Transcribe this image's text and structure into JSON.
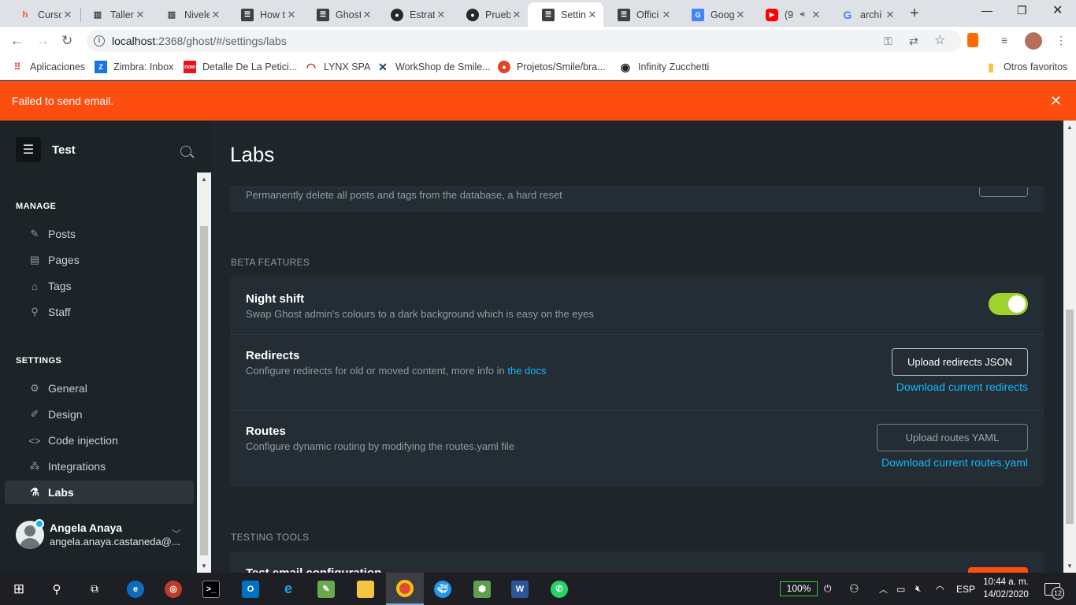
{
  "browser": {
    "tabs": [
      {
        "title": "Curso",
        "favicon": "hotmart-icon",
        "color": "#f04e23"
      },
      {
        "title": "Taller",
        "favicon": "book-icon",
        "color": "#3c4043"
      },
      {
        "title": "Nivele",
        "favicon": "book-icon",
        "color": "#3c4043"
      },
      {
        "title": "How t",
        "favicon": "ghost-icon",
        "color": "#3c4043"
      },
      {
        "title": "Ghost",
        "favicon": "ghost-icon",
        "color": "#3c4043"
      },
      {
        "title": "Estrat",
        "favicon": "github-icon",
        "color": "#24292e"
      },
      {
        "title": "Prueb",
        "favicon": "github-icon",
        "color": "#24292e"
      },
      {
        "title": "Settin",
        "favicon": "ghost-icon",
        "color": "#3c4043",
        "active": true
      },
      {
        "title": "Offici",
        "favicon": "ghost-icon",
        "color": "#3c4043"
      },
      {
        "title": "Goog",
        "favicon": "google-translate-icon",
        "color": "#4285f4"
      },
      {
        "title": "(9",
        "favicon": "youtube-icon",
        "color": "#ff0000"
      },
      {
        "title": "archi",
        "favicon": "google-icon",
        "color": "#4285f4"
      }
    ],
    "url_host": "localhost",
    "url_path": ":2368/ghost/#/settings/labs",
    "bookmarks": [
      {
        "label": "Aplicaciones",
        "icon": "apps-grid-icon"
      },
      {
        "label": "Zimbra: Inbox",
        "icon": "zimbra-icon"
      },
      {
        "label": "Detalle De La Petici...",
        "icon": "now-icon"
      },
      {
        "label": "LYNX SPA",
        "icon": "lynx-icon"
      },
      {
        "label": "WorkShop de Smile...",
        "icon": "x-icon"
      },
      {
        "label": "Projetos/Smile/bra...",
        "icon": "chrome-icon"
      },
      {
        "label": "Infinity Zucchetti",
        "icon": "infinity-icon"
      }
    ],
    "other_bookmarks": "Otros favoritos"
  },
  "alert": {
    "message": "Failed to send email."
  },
  "sidebar": {
    "site_name": "Test",
    "manage_heading": "MANAGE",
    "manage_items": [
      {
        "label": "Posts",
        "icon": "posts-icon"
      },
      {
        "label": "Pages",
        "icon": "pages-icon"
      },
      {
        "label": "Tags",
        "icon": "tag-icon"
      },
      {
        "label": "Staff",
        "icon": "staff-icon"
      }
    ],
    "settings_heading": "SETTINGS",
    "settings_items": [
      {
        "label": "General",
        "icon": "gear-icon"
      },
      {
        "label": "Design",
        "icon": "brush-icon"
      },
      {
        "label": "Code injection",
        "icon": "code-icon"
      },
      {
        "label": "Integrations",
        "icon": "integrations-icon"
      },
      {
        "label": "Labs",
        "icon": "flask-icon",
        "active": true
      }
    ],
    "user": {
      "name": "Angela Anaya",
      "email": "angela.anaya.castaneda@..."
    }
  },
  "main": {
    "title": "Labs",
    "delete_desc": "Permanently delete all posts and tags from the database, a hard reset",
    "beta_heading": "BETA FEATURES",
    "night_shift": {
      "title": "Night shift",
      "desc": "Swap Ghost admin's colours to a dark background which is easy on the eyes",
      "enabled": true
    },
    "redirects": {
      "title": "Redirects",
      "desc": "Configure redirects for old or moved content, more info in ",
      "docs_link": "the docs",
      "upload_button": "Upload redirects JSON",
      "download_link": "Download current redirects"
    },
    "routes": {
      "title": "Routes",
      "desc": "Configure dynamic routing by modifying the routes.yaml file",
      "upload_button": "Upload routes YAML",
      "download_link": "Download current routes.yaml"
    },
    "testing_heading": "TESTING TOOLS",
    "test_email_title": "Test email configuration"
  },
  "taskbar": {
    "battery": "100%",
    "language": "ESP",
    "time": "10:44 a. m.",
    "date": "14/02/2020",
    "notifications": "12"
  },
  "colors": {
    "alert": "#fe4e0f",
    "toggle_on": "#9fd22c",
    "link": "#14b8ff",
    "background": "#1e262b"
  }
}
